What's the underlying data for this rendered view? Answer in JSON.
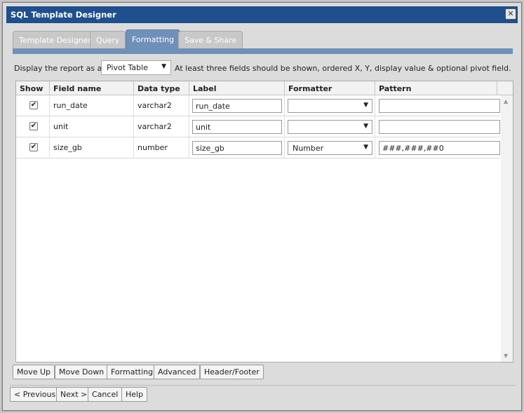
{
  "dialog": {
    "title": "SQL Template Designer"
  },
  "tabs": [
    {
      "label": "Template Designer",
      "active": false
    },
    {
      "label": "Query",
      "active": false
    },
    {
      "label": "Formatting",
      "active": true
    },
    {
      "label": "Save & Share",
      "active": false
    }
  ],
  "display": {
    "label": "Display the report as a:",
    "selected": "Pivot Table",
    "hint": "At least three fields should be shown, ordered X, Y, display value & optional pivot field."
  },
  "grid": {
    "columns": [
      "Show",
      "Field name",
      "Data type",
      "Label",
      "Formatter",
      "Pattern"
    ],
    "rows": [
      {
        "show": true,
        "field": "run_date",
        "type": "varchar2",
        "label": "run_date",
        "formatter": "",
        "pattern": ""
      },
      {
        "show": true,
        "field": "unit",
        "type": "varchar2",
        "label": "unit",
        "formatter": "",
        "pattern": ""
      },
      {
        "show": true,
        "field": "size_gb",
        "type": "number",
        "label": "size_gb",
        "formatter": "Number",
        "pattern": "###,###,##0"
      }
    ]
  },
  "grid_buttons": [
    "Move Up",
    "Move Down",
    "Formatting",
    "Advanced",
    "Header/Footer"
  ],
  "footer_buttons": [
    "< Previous",
    "Next >",
    "Cancel",
    "Help"
  ],
  "icons": {
    "close": "close-icon",
    "dropdown": "chevron-down-icon",
    "checkbox": "checkmark-icon"
  },
  "colors": {
    "titlebar": "#1f4f8c",
    "active_tab": "#6f90b8"
  }
}
